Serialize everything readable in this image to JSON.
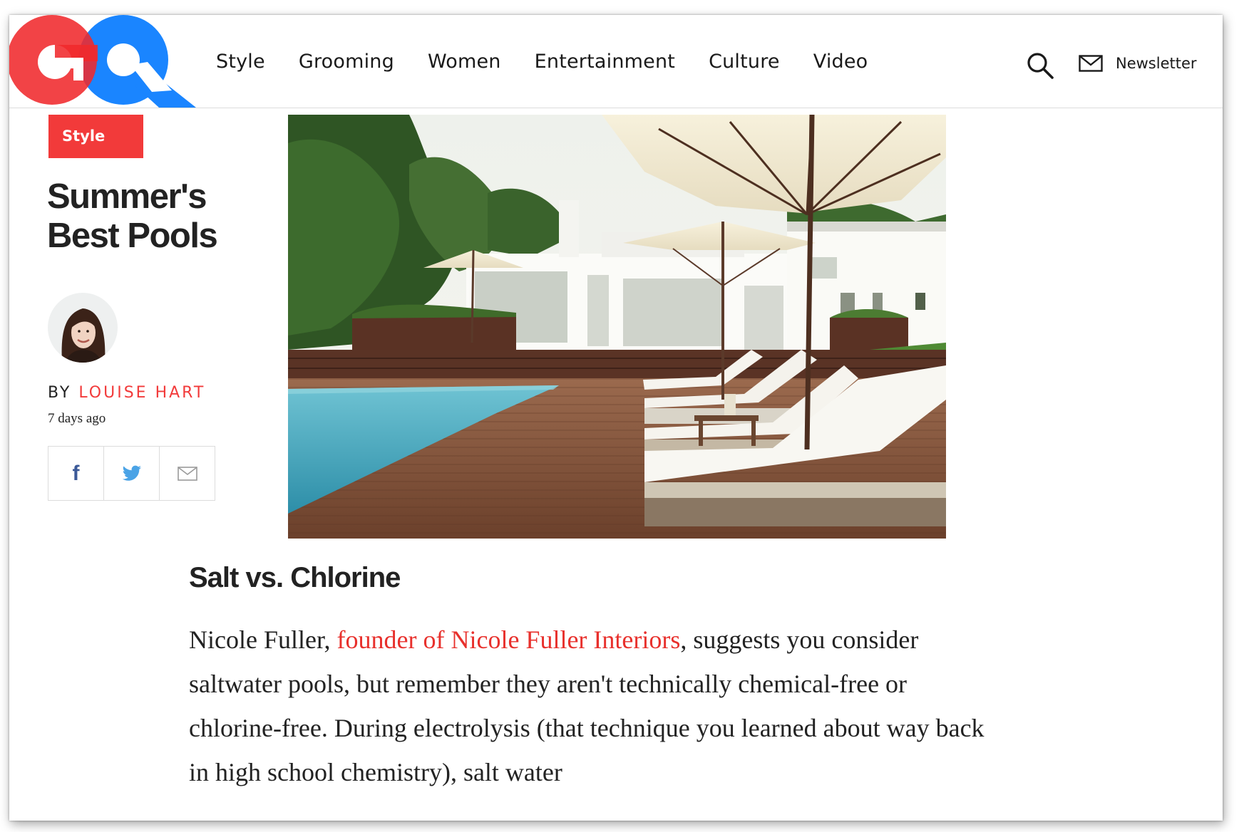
{
  "brand": {
    "logo_text": "GQ",
    "accent_color": "#f23a3a",
    "logo_blue": "#1a85ff"
  },
  "nav": {
    "items": [
      "Style",
      "Grooming",
      "Women",
      "Entertainment",
      "Culture",
      "Video"
    ],
    "search_icon": "search-icon",
    "newsletter_icon": "envelope-icon",
    "newsletter_label": "Newsletter"
  },
  "article": {
    "category": "Style",
    "title_line1": "Summer's",
    "title_line2": "Best Pools",
    "byline_prefix": "BY",
    "author": "LOUISE HART",
    "date": "7 days ago",
    "share": [
      {
        "name": "facebook",
        "icon": "facebook-icon"
      },
      {
        "name": "twitter",
        "icon": "twitter-icon"
      },
      {
        "name": "email",
        "icon": "envelope-icon"
      }
    ],
    "hero_image": "poolside deck with white lounge chairs, umbrellas and a modern white house",
    "subhead": "Salt vs. Chlorine",
    "body": {
      "intro": "Nicole Fuller, ",
      "link_text": "founder of Nicole Fuller Interiors",
      "rest": ", suggests you consider saltwater pools, but remember they aren't technically chemical-free or chlorine-free. During electrolysis (that technique you learned about way back in high school chemistry), salt water"
    }
  }
}
